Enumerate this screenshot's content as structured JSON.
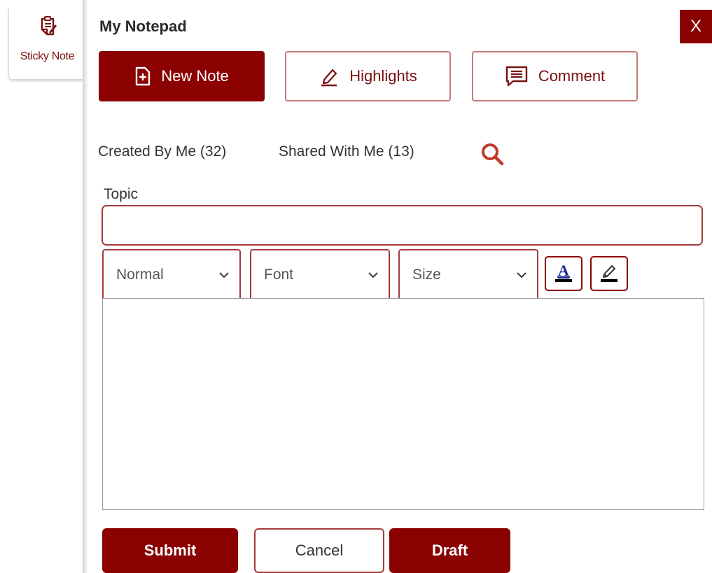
{
  "sidebar": {
    "tab_label": "Sticky Note",
    "tab_icon": "sticky-note-icon"
  },
  "header": {
    "title": "My Notepad",
    "close_label": "X"
  },
  "toolbar": {
    "new_note": {
      "label": "New Note",
      "icon": "file-plus-icon"
    },
    "highlights": {
      "label": "Highlights",
      "icon": "highlighter-icon"
    },
    "comment": {
      "label": "Comment",
      "icon": "comment-icon"
    }
  },
  "filters": {
    "created_by_me": "Created By Me (32)",
    "shared_with_me": "Shared With Me (13)",
    "search_icon": "search-icon"
  },
  "form": {
    "topic_label": "Topic",
    "topic_value": "",
    "format_select": "Normal",
    "font_select": "Font",
    "size_select": "Size",
    "text_color_icon": "text-color-icon",
    "highlight_color_icon": "highlight-pen-icon",
    "body_text": ""
  },
  "actions": {
    "submit": "Submit",
    "cancel": "Cancel",
    "draft": "Draft"
  },
  "colors": {
    "accent": "#8b0000",
    "border": "#a53b3b"
  }
}
